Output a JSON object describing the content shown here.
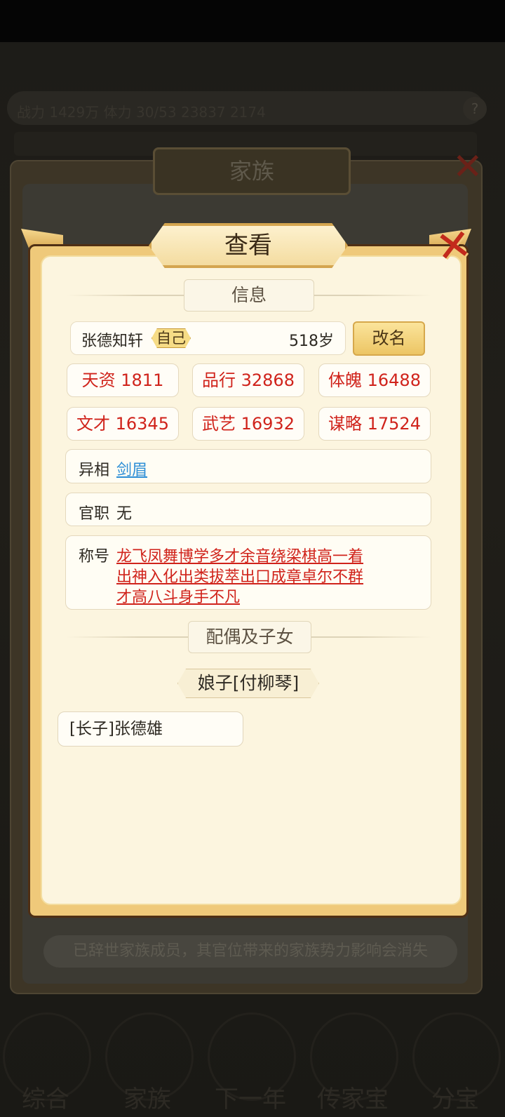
{
  "background": {
    "status_bar_text": "战力 1429万  体力  30/53  23837  2174",
    "family_window": {
      "title": "家族",
      "notice": "已辞世家族成员，其官位带来的家族势力影响会消失"
    },
    "bottom_nav": [
      "综合",
      "家族",
      "下一年",
      "传家宝",
      "分宝"
    ]
  },
  "dialog": {
    "title": "查看",
    "info_section": "信息",
    "name": "张德知轩",
    "self_badge": "自己",
    "age": "518岁",
    "rename_button": "改名",
    "stats": [
      {
        "label": "天资 1811"
      },
      {
        "label": "品行 32868"
      },
      {
        "label": "体魄 16488"
      },
      {
        "label": "文才 16345"
      },
      {
        "label": "武艺 16932"
      },
      {
        "label": "谋略 17524"
      }
    ],
    "appearance": {
      "label": "异相",
      "value": "剑眉"
    },
    "official_post": {
      "label": "官职",
      "value": "无"
    },
    "titles": {
      "label": "称号",
      "lines": [
        "龙飞凤舞博学多才余音绕梁棋高一着",
        "出神入化出类拔萃出口成章卓尔不群",
        "才高八斗身手不凡"
      ]
    },
    "family_section": "配偶及子女",
    "spouse": "娘子[付柳琴]",
    "children": [
      "[长子]张德雄"
    ]
  },
  "colors": {
    "stat_red": "#d0231b",
    "link_blue": "#2c8ed6",
    "gold": "#efc97a",
    "panel": "#fcf5df"
  }
}
